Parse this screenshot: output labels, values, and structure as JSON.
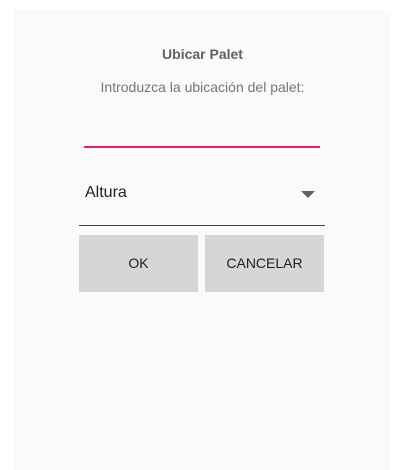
{
  "dialog": {
    "title": "Ubicar Palet",
    "message": "Introduzca la ubicación del palet:",
    "location_input": {
      "value": "",
      "placeholder": ""
    },
    "height_spinner": {
      "selected": "Altura",
      "icon": "dropdown-arrow-icon"
    },
    "buttons": {
      "ok_label": "OK",
      "cancel_label": "CANCELAR"
    }
  },
  "colors": {
    "accent": "#e91e63",
    "dialog_background": "#fafafa",
    "button_background": "#d6d6d6"
  }
}
